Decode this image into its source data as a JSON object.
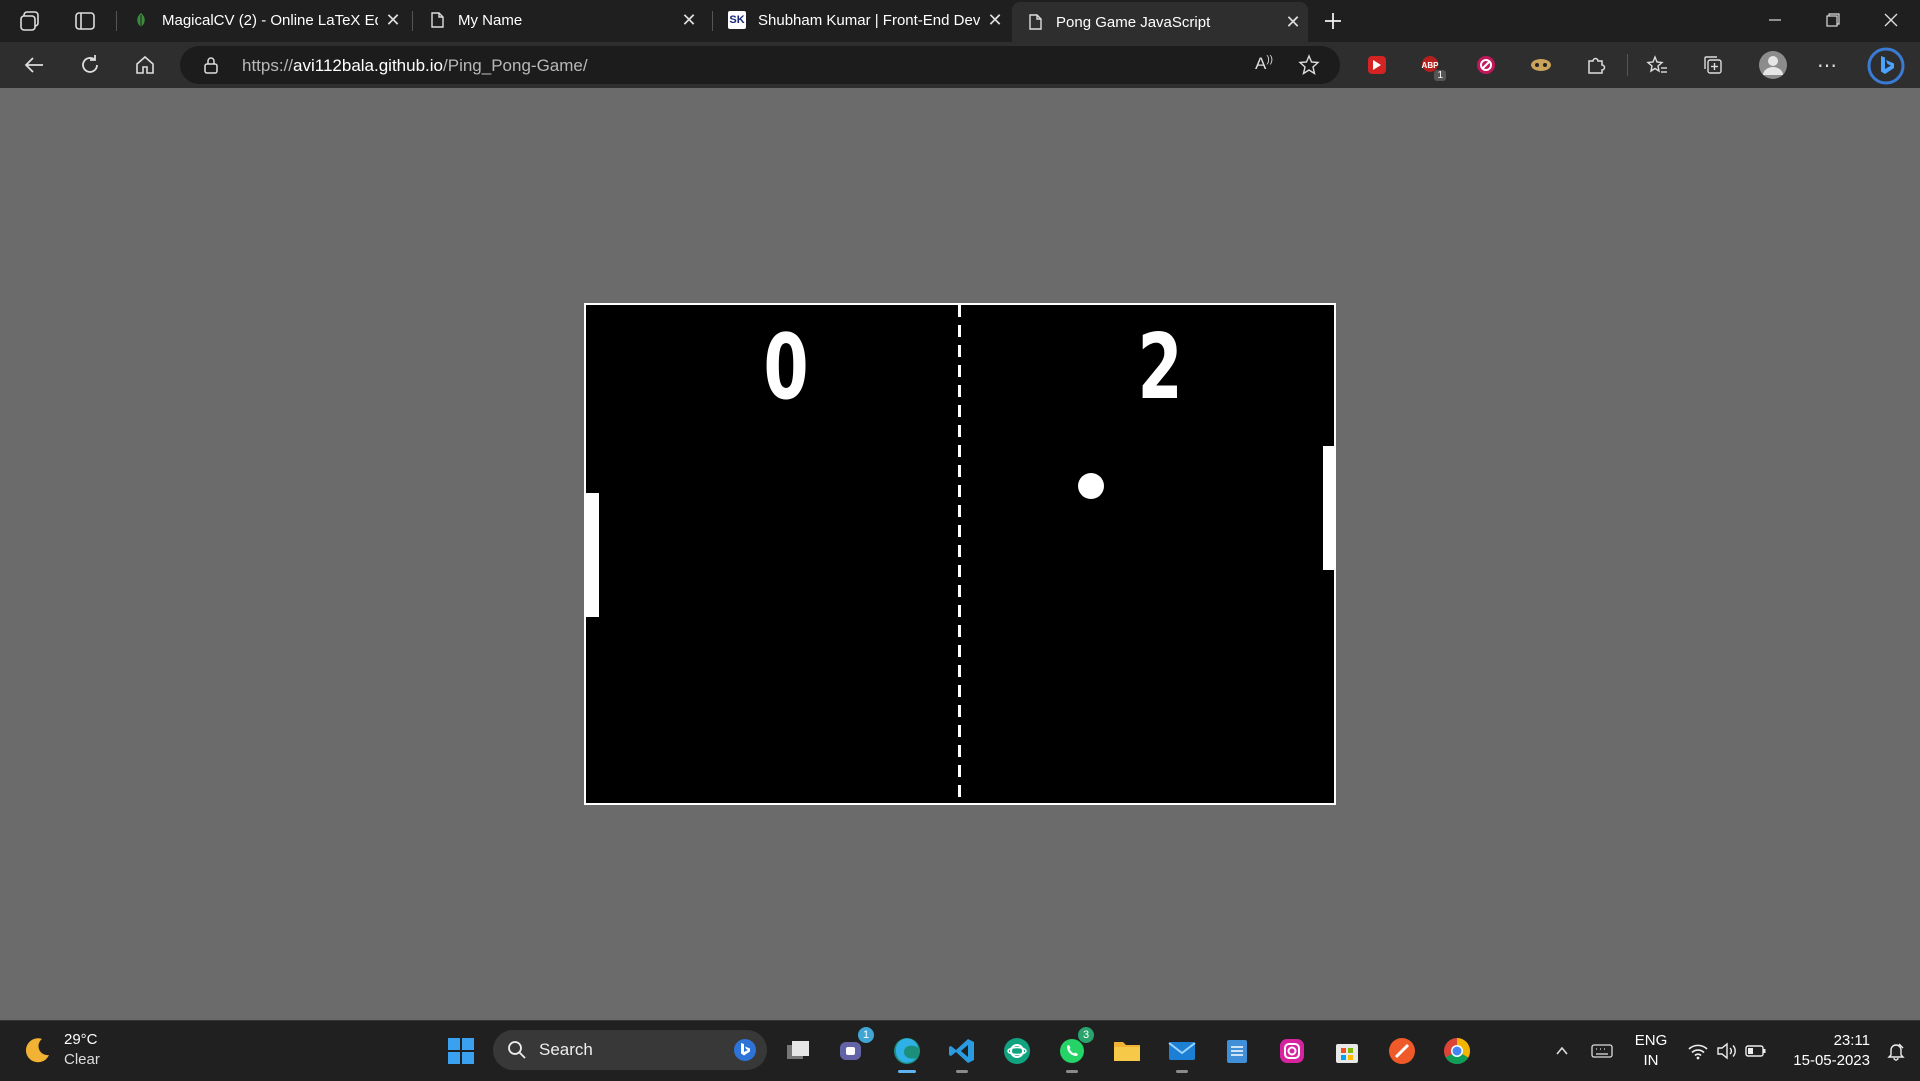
{
  "browser": {
    "tabs": [
      {
        "title": "MagicalCV (2) - Online LaTeX Edi",
        "favicon": "leaf-icon"
      },
      {
        "title": "My Name",
        "favicon": "page-icon"
      },
      {
        "title": "Shubham Kumar | Front-End Dev",
        "favicon": "sk-logo-icon",
        "favicon_text": "SK"
      },
      {
        "title": "Pong Game JavaScript",
        "favicon": "page-icon",
        "active": true
      }
    ],
    "address": {
      "scheme": "https://",
      "host": "avi112bala.github.io",
      "path": "/Ping_Pong-Game/"
    },
    "extension_badge": "1"
  },
  "game": {
    "left_score": "0",
    "right_score": "2",
    "colors": {
      "background": "#000000",
      "foreground": "#ffffff"
    }
  },
  "taskbar": {
    "weather": {
      "temperature": "29°C",
      "condition": "Clear"
    },
    "search_label": "Search",
    "teams_badge": "1",
    "whatsapp_badge": "3",
    "language": {
      "top": "ENG",
      "bottom": "IN"
    },
    "clock": {
      "time": "23:11",
      "date": "15-05-2023"
    }
  }
}
